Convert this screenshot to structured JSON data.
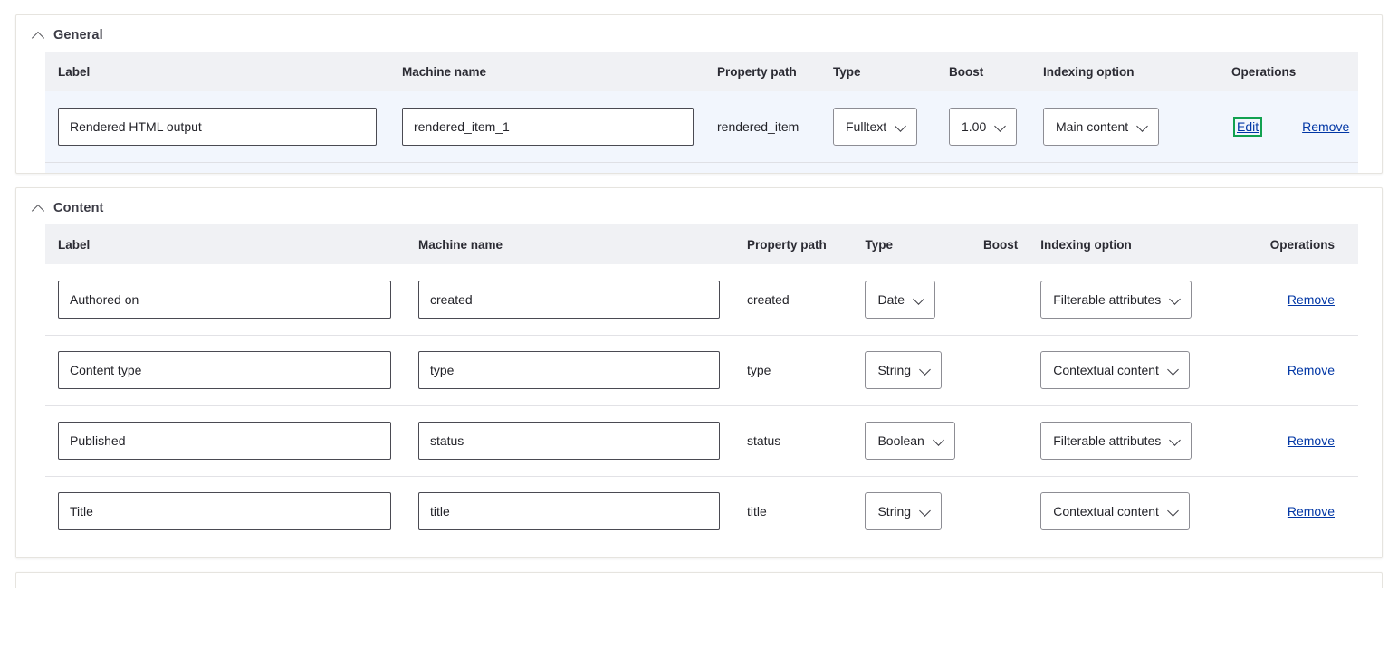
{
  "sections": [
    {
      "id": "general",
      "title": "General",
      "collapse_icon": "chevron-up-icon",
      "columns": [
        "Label",
        "Machine name",
        "Property path",
        "Type",
        "Boost",
        "Indexing option",
        "Operations"
      ],
      "rows": [
        {
          "label": "Rendered HTML output",
          "machine_name": "rendered_item_1",
          "property_path": "rendered_item",
          "type": "Fulltext",
          "boost": "1.00",
          "indexing_option": "Main content",
          "operations": {
            "edit": "Edit",
            "remove": "Remove",
            "edit_highlighted": true
          }
        }
      ]
    },
    {
      "id": "content",
      "title": "Content",
      "collapse_icon": "chevron-up-icon",
      "columns": [
        "Label",
        "Machine name",
        "Property path",
        "Type",
        "Boost",
        "Indexing option",
        "Operations"
      ],
      "rows": [
        {
          "label": "Authored on",
          "machine_name": "created",
          "property_path": "created",
          "type": "Date",
          "boost": "",
          "indexing_option": "Filterable attributes",
          "operations": {
            "remove": "Remove"
          }
        },
        {
          "label": "Content type",
          "machine_name": "type",
          "property_path": "type",
          "type": "String",
          "boost": "",
          "indexing_option": "Contextual content",
          "operations": {
            "remove": "Remove"
          }
        },
        {
          "label": "Published",
          "machine_name": "status",
          "property_path": "status",
          "type": "Boolean",
          "boost": "",
          "indexing_option": "Filterable attributes",
          "operations": {
            "remove": "Remove"
          }
        },
        {
          "label": "Title",
          "machine_name": "title",
          "property_path": "title",
          "type": "String",
          "boost": "",
          "indexing_option": "Contextual content",
          "operations": {
            "remove": "Remove"
          }
        }
      ]
    }
  ],
  "colors": {
    "highlight_border": "#12a150",
    "link": "#0036a5",
    "header_bg": "#f0f1f4",
    "general_row_bg": "#f2f6fd"
  }
}
